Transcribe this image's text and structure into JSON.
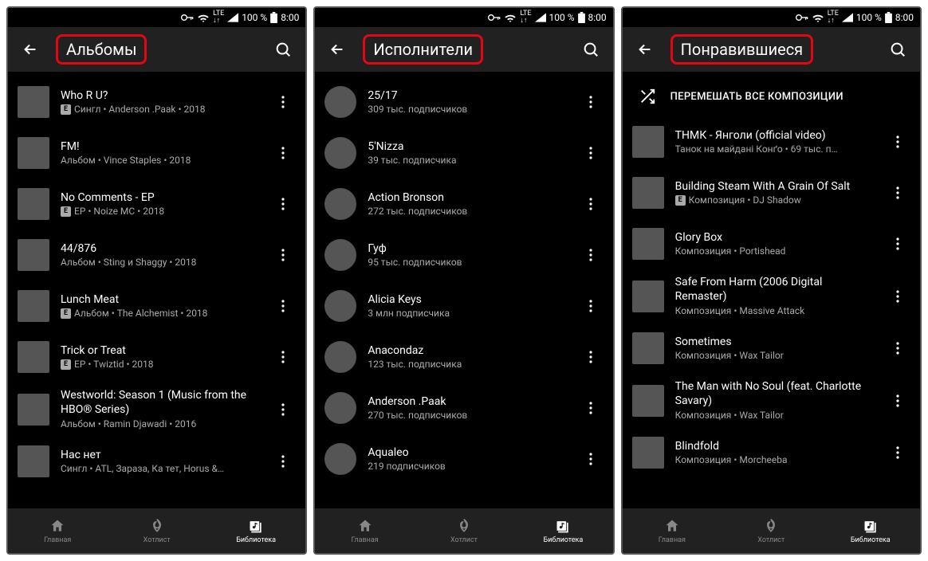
{
  "status": {
    "lte": "LTE",
    "battery_pct": "100 %",
    "time": "8:00"
  },
  "screens": [
    {
      "title": "Альбомы",
      "type": "albums",
      "items": [
        {
          "title": "Who R U?",
          "sub": "Сингл • Anderson .Paak • 2018",
          "explicit": true
        },
        {
          "title": "FM!",
          "sub": "Альбом • Vince Staples • 2018",
          "explicit": false
        },
        {
          "title": "No Comments - EP",
          "sub": "EP • Noize MC • 2018",
          "explicit": true
        },
        {
          "title": "44/876",
          "sub": "Альбом • Sting и Shaggy • 2018",
          "explicit": false
        },
        {
          "title": "Lunch Meat",
          "sub": "Альбом • The Alchemist • 2018",
          "explicit": true
        },
        {
          "title": "Trick or Treat",
          "sub": "EP • Twiztid • 2018",
          "explicit": true
        },
        {
          "title": "Westworld: Season 1 (Music from the HBO® Series)",
          "sub": "Альбом • Ramin Djawadi • 2016",
          "explicit": false,
          "wrap": true
        },
        {
          "title": "Нас нет",
          "sub": "Сингл • ATL, Зараза, Ка тет, Horus &…",
          "explicit": false
        }
      ]
    },
    {
      "title": "Исполнители",
      "type": "artists",
      "items": [
        {
          "title": "25/17",
          "sub": "309 тыс. подписчиков"
        },
        {
          "title": "5'Nizza",
          "sub": "39 тыс. подписчика"
        },
        {
          "title": "Action Bronson",
          "sub": "272 тыс. подписчиков"
        },
        {
          "title": "Гуф",
          "sub": "95 тыс. подписчиков"
        },
        {
          "title": "Alicia Keys",
          "sub": "3 млн подписчика"
        },
        {
          "title": "Anacondaz",
          "sub": "123 тыс. подписчика"
        },
        {
          "title": "Anderson .Paak",
          "sub": "270 тыс. подписчиков"
        },
        {
          "title": "Aqualeo",
          "sub": "219 подписчиков"
        }
      ]
    },
    {
      "title": "Понравившиеся",
      "type": "liked",
      "shuffle_label": "ПЕРЕМЕШАТЬ ВСЕ КОМПОЗИЦИИ",
      "items": [
        {
          "title": "ТНМК - Янголи (official video)",
          "sub": "Танок на майдані Конґо • 69 тыс. п…",
          "explicit": false
        },
        {
          "title": "Building Steam With A Grain Of Salt",
          "sub": "Композиция • DJ Shadow",
          "explicit": true
        },
        {
          "title": "Glory Box",
          "sub": "Композиция • Portishead",
          "explicit": false
        },
        {
          "title": "Safe From Harm (2006 Digital Remaster)",
          "sub": "Композиция • Massive Attack",
          "explicit": false,
          "wrap": true
        },
        {
          "title": "Sometimes",
          "sub": "Композиция • Wax Tailor",
          "explicit": false
        },
        {
          "title": "The Man with No Soul (feat. Charlotte Savary)",
          "sub": "Композиция • Wax Tailor",
          "explicit": false,
          "wrap": true
        },
        {
          "title": "Blindfold",
          "sub": "Композиция • Morcheeba",
          "explicit": false
        }
      ]
    }
  ],
  "nav": {
    "home": "Главная",
    "hotlist": "Хотлист",
    "library": "Библиотека"
  }
}
